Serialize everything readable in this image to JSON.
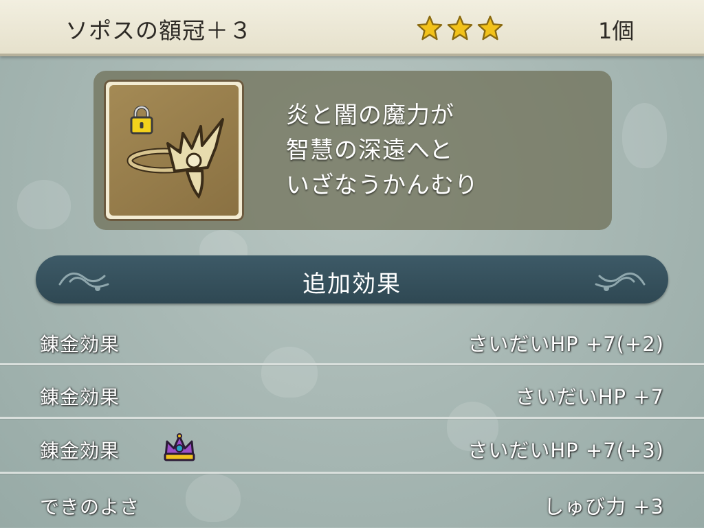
{
  "header": {
    "item_name": "ソポスの額冠＋３",
    "star_count": 3,
    "count_label": "1個",
    "star_color": "#f2c21a"
  },
  "description": {
    "icons": [
      "lock-icon",
      "circlet-icon"
    ],
    "lines": [
      "炎と闇の魔力が",
      "智慧の深遠へと",
      "いざなうかんむり"
    ]
  },
  "section": {
    "title": "追加効果"
  },
  "effects": [
    {
      "label": "錬金効果",
      "value": "さいだいHP +7(+2)",
      "icon": null
    },
    {
      "label": "錬金効果",
      "value": "さいだいHP +7",
      "icon": null
    },
    {
      "label": "錬金効果",
      "value": "さいだいHP +7(+3)",
      "icon": "crown-icon"
    },
    {
      "label": "できのよさ",
      "value": "しゅび力 +3",
      "icon": null
    }
  ]
}
